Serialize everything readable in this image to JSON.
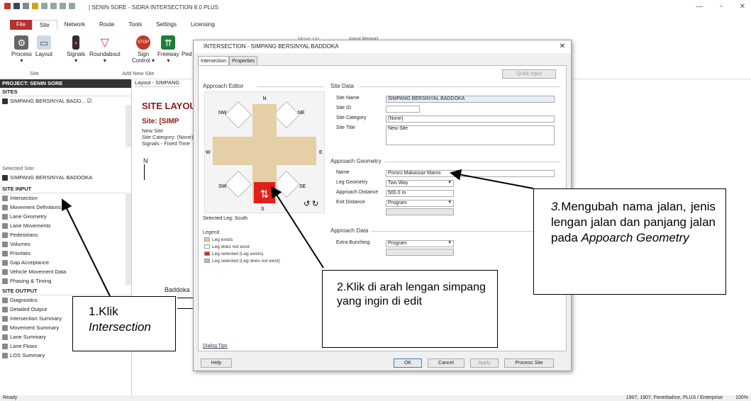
{
  "app": {
    "title": "| SENIN SORE - SIDRA INTERSECTION 8.0 PLUS",
    "controls": {
      "minimize": "—",
      "restore": "▫",
      "close": "✕"
    }
  },
  "menu": [
    "File",
    "Site",
    "Network",
    "Route",
    "Tools",
    "Settings",
    "Licensing"
  ],
  "ribbon": {
    "buttons": [
      {
        "label": "Process",
        "sub": "▾",
        "icon": "gear-icon"
      },
      {
        "label": "Layout",
        "sub": "",
        "icon": "layout-icon"
      },
      {
        "label": "Signals",
        "sub": "▾",
        "icon": "traffic-light-icon"
      },
      {
        "label": "Roundabout",
        "sub": "▾",
        "icon": "yield-icon"
      },
      {
        "label": "Sign",
        "sub": "Control ▾",
        "icon": "stop-sign-icon"
      },
      {
        "label": "Freeway",
        "sub": "▾",
        "icon": "freeway-icon"
      },
      {
        "label": "Ped",
        "sub": "",
        "icon": "pedestrian-icon"
      }
    ],
    "groups": [
      "Site",
      "Add New Site"
    ],
    "background_items": [
      "Move Up",
      "Input Report"
    ]
  },
  "left_panel": {
    "project": "PROJECT: SENIN SORE",
    "sites_header": "SITES",
    "site_item": "SIMPANG BERSINYAL BADD...",
    "selected_site_label": "Selected Site:",
    "selected_site": "SIMPANG BERSINYAL BADDOKA",
    "site_input_header": "SITE INPUT",
    "site_input": [
      "Intersection",
      "Movement Definitions",
      "Lane Geometry",
      "Lane Movements",
      "Pedestrians",
      "Volumes",
      "Priorities",
      "Gap Acceptance",
      "Vehicle Movement Data",
      "Phasing & Timing"
    ],
    "site_output_header": "SITE OUTPUT",
    "site_output": [
      "Diagnostics",
      "Detailed Output",
      "Intersection Summary",
      "Movement Summary",
      "Lane Summary",
      "Lane Flows",
      "LOS Summary"
    ]
  },
  "document": {
    "tab": "Layout - SIMPANG",
    "heading": "SITE LAYOUT",
    "site_line": "Site: [SIMP",
    "details": [
      "New Site",
      "Site Category: (None)",
      "Signals - Fixed Time"
    ],
    "north": "N",
    "street": "Baddoka"
  },
  "dialog": {
    "title": "INTERSECTION - SIMPANG BERSINYAL BADDOKA",
    "close": "✕",
    "tabs": [
      "Intersection",
      "Properties"
    ],
    "quick_input": "Quick Input",
    "approach_editor": "Approach Editor",
    "compass": {
      "N": "N",
      "NE": "NE",
      "E": "E",
      "SE": "SE",
      "S": "S",
      "SW": "SW",
      "W": "W",
      "NW": "NW"
    },
    "selected_leg": "Selected Leg: South",
    "legend_title": "Legend",
    "legend": [
      {
        "label": "Leg exists",
        "color": "#e5cfa6"
      },
      {
        "label": "Leg does not exist",
        "color": "#ffffff"
      },
      {
        "label": "Leg selected (Leg exists)",
        "color": "#e0211b"
      },
      {
        "label": "Leg selected (Leg does not exist)",
        "color": "#f2a6a6"
      }
    ],
    "dialog_tips": "Dialog Tips",
    "site_data": {
      "header": "Site Data",
      "name_label": "Site Name",
      "name": "SIMPANG BERSINYAL BADDOKA",
      "id_label": "Site ID",
      "id": "",
      "category_label": "Site Category",
      "category": "(None)",
      "title_label": "Site Title",
      "title": "New Site"
    },
    "geometry": {
      "header": "Approach Geometry",
      "name_label": "Name",
      "name": "Porors Makassar-Maros",
      "leg_label": "Leg Geometry",
      "leg": "Two Way",
      "dist_label": "Approach Distance",
      "dist": "500.0 m",
      "exit_label": "Exit Distance",
      "exit": "Program"
    },
    "approach_data": {
      "header": "Approach Data",
      "bunching_label": "Extra Bunching",
      "bunching": "Program"
    },
    "buttons": {
      "help": "Help",
      "ok": "OK",
      "cancel": "Cancel",
      "apply": "Apply",
      "process": "Process Site"
    }
  },
  "annotations": {
    "a1_num": "1.Klik",
    "a1_text": "Intersection",
    "a2": "2.Klik di arah lengan simpang yang ingin di edit",
    "a3_num": "3.",
    "a3_text": "Mengubah nama jalan, jenis lengan jalan dan panjang jalan pada",
    "a3_em": "Appoarch Geometry"
  },
  "status": {
    "left": "Ready",
    "right": "1907, 1907, Fenerbahce, PLUS / Enterprise",
    "zoom": "100%"
  },
  "colors": {
    "leg": "#e5cfa6",
    "selected": "#e0211b",
    "accent": "#b7312c",
    "heading": "#8b1a12"
  }
}
